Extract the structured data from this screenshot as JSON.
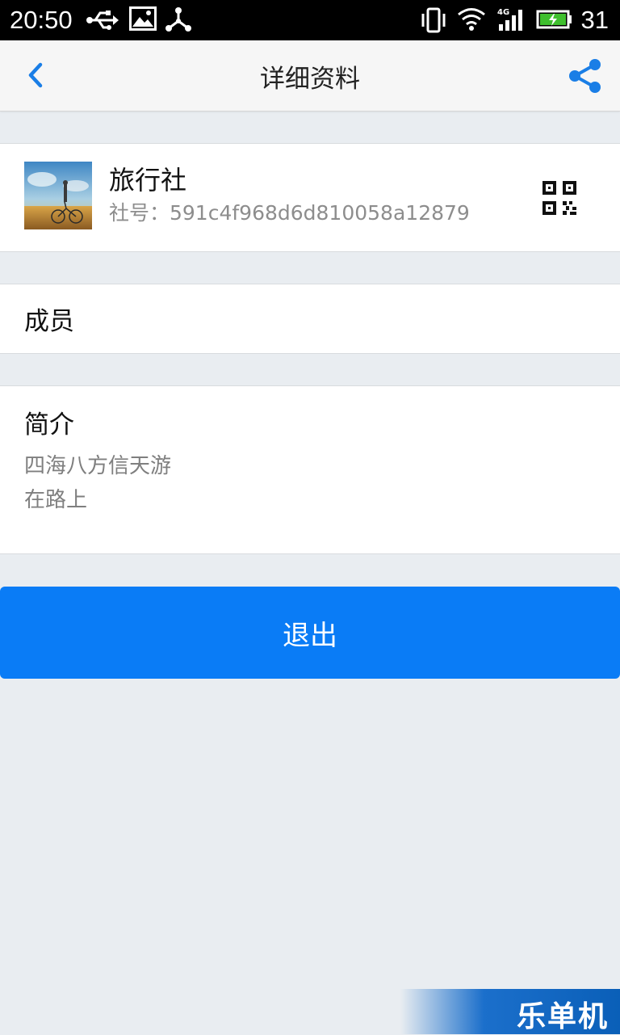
{
  "status_bar": {
    "time": "20:50",
    "battery_level": "31",
    "network": "4G",
    "icons": [
      "usb-icon",
      "image-icon",
      "share-network-icon",
      "vibrate-icon",
      "wifi-icon",
      "signal-icon",
      "battery-charging-icon"
    ]
  },
  "header": {
    "title": "详细资料",
    "back_icon": "chevron-left-icon",
    "share_icon": "share-icon",
    "accent": "#1a7ee6"
  },
  "profile": {
    "name": "旅行社",
    "id_text": "社号：591c4f968d6d810058a12879",
    "qr_icon": "qr-code-icon"
  },
  "members": {
    "label": "成员"
  },
  "intro": {
    "title": "简介",
    "lines": [
      "四海八方信天游",
      "在路上"
    ]
  },
  "actions": {
    "exit_label": "退出",
    "exit_color": "#0a7cf6"
  },
  "watermark": {
    "text": "乐单机"
  }
}
